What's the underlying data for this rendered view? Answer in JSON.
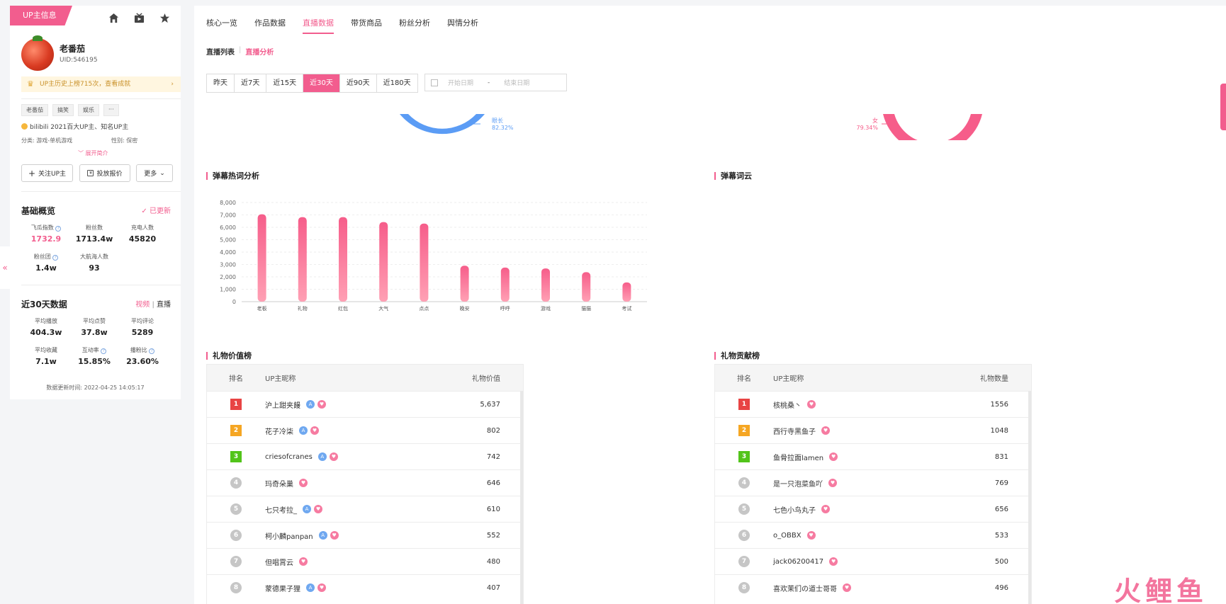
{
  "sidebar": {
    "tag": "UP主信息",
    "user": {
      "name": "老番茄",
      "uid": "UID:546195"
    },
    "history": "UP主历史上榜715次，查看成就",
    "tags": [
      "老番茄",
      "搞笑",
      "娱乐",
      "···"
    ],
    "description": "bilibili 2021百大UP主、知名UP主",
    "category": "分类: 游戏-单机游戏",
    "gender": "性别: 保密",
    "expand": "展开简介",
    "buttons": {
      "follow": "关注UP主",
      "quote": "投放报价",
      "more": "更多"
    },
    "overview": {
      "title": "基础概览",
      "updated": "已更新",
      "stats": [
        {
          "label": "飞瓜指数",
          "value": "1732.9"
        },
        {
          "label": "粉丝数",
          "value": "1713.4w"
        },
        {
          "label": "充电人数",
          "value": "45820"
        },
        {
          "label": "粉丝团",
          "value": "1.4w"
        },
        {
          "label": "大航海人数",
          "value": "93"
        }
      ]
    },
    "recent": {
      "title": "近30天数据",
      "switch": {
        "video": "视频",
        "sep": "|",
        "live": "直播"
      },
      "stats": [
        {
          "label": "平均播放",
          "value": "404.3w"
        },
        {
          "label": "平均点赞",
          "value": "37.8w"
        },
        {
          "label": "平均评论",
          "value": "5289"
        },
        {
          "label": "平均收藏",
          "value": "7.1w"
        },
        {
          "label": "互动率",
          "value": "15.85%"
        },
        {
          "label": "播粉比",
          "value": "23.60%"
        }
      ],
      "update_time": "数据更新时间:   2022-04-25 14:05:17"
    }
  },
  "main": {
    "tabs": [
      "核心一览",
      "作品数据",
      "直播数据",
      "带货商品",
      "粉丝分析",
      "舆情分析"
    ],
    "subnav": {
      "list": "直播列表",
      "sep": "|",
      "analysis": "直播分析"
    },
    "ranges": [
      "昨天",
      "近7天",
      "近15天",
      "近30天",
      "近90天",
      "近180天"
    ],
    "date_start": "开始日期",
    "date_dash": "-",
    "date_end": "结束日期",
    "donut_left": {
      "label": "眼长",
      "value": "82.32%"
    },
    "donut_right": {
      "label": "女",
      "value": "79.34%"
    },
    "danmaku_title": "弹幕热词分析",
    "cloud_title": "弹幕词云",
    "gift_value": {
      "title": "礼物价值榜",
      "headers": [
        "排名",
        "UP主昵称",
        "礼物价值"
      ],
      "rows": [
        {
          "rank": "1",
          "name": "沪上甜夹饅",
          "badge": true,
          "value": "5,637"
        },
        {
          "rank": "2",
          "name": "花子冷柒",
          "badge": true,
          "value": "802"
        },
        {
          "rank": "3",
          "name": "criesofcranes",
          "badge": true,
          "value": "742"
        },
        {
          "rank": "4",
          "name": "玛奇朵巢",
          "badge": false,
          "value": "646"
        },
        {
          "rank": "5",
          "name": "七只考拉_",
          "badge": true,
          "value": "610"
        },
        {
          "rank": "6",
          "name": "柯小麟panpan",
          "badge": true,
          "value": "552"
        },
        {
          "rank": "7",
          "name": "但唱霄云",
          "badge": false,
          "value": "480"
        },
        {
          "rank": "8",
          "name": "蒙德果子狸",
          "badge": true,
          "value": "407"
        }
      ]
    },
    "gift_contrib": {
      "title": "礼物贡献榜",
      "headers": [
        "排名",
        "UP主昵称",
        "礼物数量"
      ],
      "rows": [
        {
          "rank": "1",
          "name": "核桃桑丶",
          "value": "1556"
        },
        {
          "rank": "2",
          "name": "西行寺黑鱼子",
          "value": "1048"
        },
        {
          "rank": "3",
          "name": "鱼骨拉面lamen",
          "value": "831"
        },
        {
          "rank": "4",
          "name": "是一只泡菜鱼吖",
          "value": "769"
        },
        {
          "rank": "5",
          "name": "七色小鸟丸子",
          "value": "656"
        },
        {
          "rank": "6",
          "name": "o_OBBX",
          "value": "533"
        },
        {
          "rank": "7",
          "name": "jack06200417",
          "value": "500"
        },
        {
          "rank": "8",
          "name": "喜欢茉们の道士哥哥",
          "value": "496"
        }
      ]
    }
  },
  "watermark": "火鲤鱼",
  "colors": {
    "accent": "#f25d8e",
    "blue": "#5b9cf5"
  },
  "chart_data": {
    "type": "bar",
    "title": "弹幕热词分析",
    "categories": [
      "老板",
      "礼物",
      "红包",
      "大气",
      "点点",
      "晚安",
      "呼呼",
      "游戏",
      "猫猫",
      "考试"
    ],
    "values": [
      7050,
      6820,
      6820,
      6420,
      6300,
      2900,
      2750,
      2680,
      2380,
      1550
    ],
    "ylim": [
      0,
      8000
    ],
    "yticks": [
      "0",
      "1,000",
      "2,000",
      "3,000",
      "4,000",
      "5,000",
      "6,000",
      "7,000",
      "8,000"
    ],
    "grid": true
  }
}
